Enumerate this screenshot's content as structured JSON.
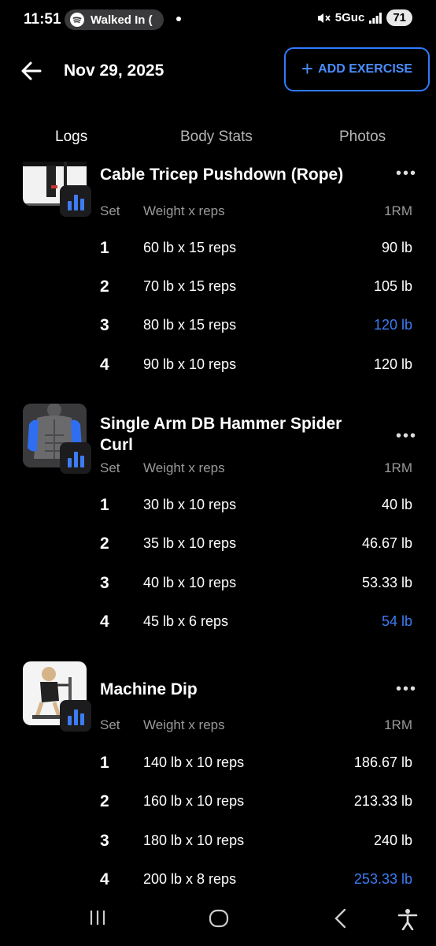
{
  "status_bar": {
    "time": "11:51",
    "media_text": "Walked In (",
    "network": "5Guc",
    "battery": "71"
  },
  "header": {
    "date": "Nov 29, 2025",
    "add_exercise_label": "ADD EXERCISE"
  },
  "tabs": [
    {
      "label": "Logs",
      "active": true
    },
    {
      "label": "Body Stats",
      "active": false
    },
    {
      "label": "Photos",
      "active": false
    }
  ],
  "columns": {
    "set": "Set",
    "weight_reps": "Weight x reps",
    "one_rm": "1RM"
  },
  "exercises": [
    {
      "name": "Cable Tricep Pushdown (Rope)",
      "sets": [
        {
          "set": "1",
          "weight_reps": "60 lb x 15 reps",
          "one_rm": "90 lb",
          "pr": false
        },
        {
          "set": "2",
          "weight_reps": "70 lb x 15 reps",
          "one_rm": "105 lb",
          "pr": false
        },
        {
          "set": "3",
          "weight_reps": "80 lb x 15 reps",
          "one_rm": "120 lb",
          "pr": true
        },
        {
          "set": "4",
          "weight_reps": "90 lb x 10 reps",
          "one_rm": "120 lb",
          "pr": false
        }
      ]
    },
    {
      "name": "Single Arm DB Hammer Spider Curl",
      "sets": [
        {
          "set": "1",
          "weight_reps": "30 lb x 10 reps",
          "one_rm": "40 lb",
          "pr": false
        },
        {
          "set": "2",
          "weight_reps": "35 lb x 10 reps",
          "one_rm": "46.67 lb",
          "pr": false
        },
        {
          "set": "3",
          "weight_reps": "40 lb x 10 reps",
          "one_rm": "53.33 lb",
          "pr": false
        },
        {
          "set": "4",
          "weight_reps": "45 lb x 6 reps",
          "one_rm": "54 lb",
          "pr": true
        }
      ]
    },
    {
      "name": "Machine Dip",
      "sets": [
        {
          "set": "1",
          "weight_reps": "140 lb x 10 reps",
          "one_rm": "186.67 lb",
          "pr": false
        },
        {
          "set": "2",
          "weight_reps": "160 lb x 10 reps",
          "one_rm": "213.33 lb",
          "pr": false
        },
        {
          "set": "3",
          "weight_reps": "180 lb x 10 reps",
          "one_rm": "240 lb",
          "pr": false
        },
        {
          "set": "4",
          "weight_reps": "200 lb x 8 reps",
          "one_rm": "253.33 lb",
          "pr": true
        }
      ]
    }
  ],
  "colors": {
    "accent": "#3d7cf2",
    "background": "#000000"
  },
  "icons": [
    "back-arrow-icon",
    "plus-icon",
    "stats-icon",
    "more-icon",
    "recents-icon",
    "home-icon",
    "back-nav-icon",
    "accessibility-icon"
  ]
}
